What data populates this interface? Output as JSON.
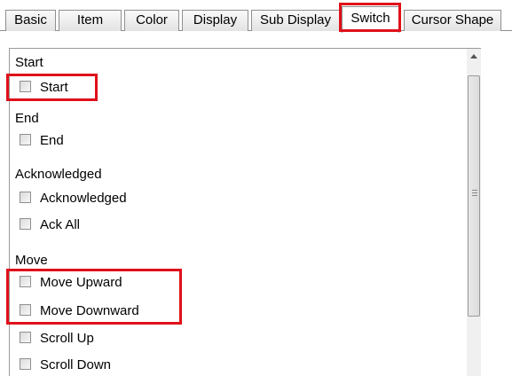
{
  "tabs": [
    {
      "label": "Basic",
      "active": false
    },
    {
      "label": "Item",
      "active": false
    },
    {
      "label": "Color",
      "active": false
    },
    {
      "label": "Display",
      "active": false
    },
    {
      "label": "Sub Display",
      "active": false
    },
    {
      "label": "Switch",
      "active": true
    },
    {
      "label": "Cursor Shape",
      "active": false
    }
  ],
  "groups": {
    "start": {
      "label": "Start",
      "items": [
        {
          "label": "Start",
          "checked": false
        }
      ]
    },
    "end": {
      "label": "End",
      "items": [
        {
          "label": "End",
          "checked": false
        }
      ]
    },
    "acknowledged": {
      "label": "Acknowledged",
      "items": [
        {
          "label": "Acknowledged",
          "checked": false
        },
        {
          "label": "Ack All",
          "checked": false
        }
      ]
    },
    "move": {
      "label": "Move",
      "items": [
        {
          "label": "Move Upward",
          "checked": false
        },
        {
          "label": "Move Downward",
          "checked": false
        },
        {
          "label": "Scroll Up",
          "checked": false
        },
        {
          "label": "Scroll Down",
          "checked": false
        }
      ]
    }
  },
  "highlight_color": "#e0101a",
  "icons": {
    "scroll_up": "chevron-up-icon",
    "scroll_grip": "grip-icon"
  }
}
